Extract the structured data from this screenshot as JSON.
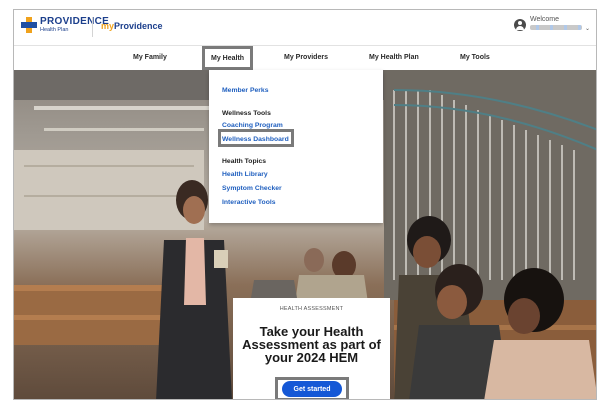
{
  "header": {
    "logo_name": "PROVIDENCE",
    "logo_sub": "Health Plan",
    "brand_prefix": "my",
    "brand_name": "Providence",
    "welcome": "Welcome"
  },
  "nav": {
    "items": [
      "My Family",
      "My Health",
      "My Providers",
      "My Health Plan",
      "My Tools"
    ],
    "active": "My Health"
  },
  "dropdown": {
    "member_perks": "Member Perks",
    "wellness_tools_heading": "Wellness Tools",
    "coaching_program": "Coaching Program",
    "wellness_dashboard": "Wellness Dashboard",
    "health_topics_heading": "Health Topics",
    "health_library": "Health Library",
    "symptom_checker": "Symptom Checker",
    "interactive_tools": "Interactive Tools"
  },
  "card": {
    "label": "HEALTH ASSESSMENT",
    "title": "Take your Health Assessment as part of your 2024 HEM",
    "cta": "Get started"
  },
  "colors": {
    "brand_blue": "#1c3f8c",
    "brand_orange": "#f0a21c",
    "link_blue": "#1f5fbf",
    "cta_blue": "#1558d6",
    "highlight_gray": "#7a7a7a"
  },
  "icons": [
    "providence-cross-logo",
    "user-avatar-icon",
    "chevron-down-icon"
  ]
}
